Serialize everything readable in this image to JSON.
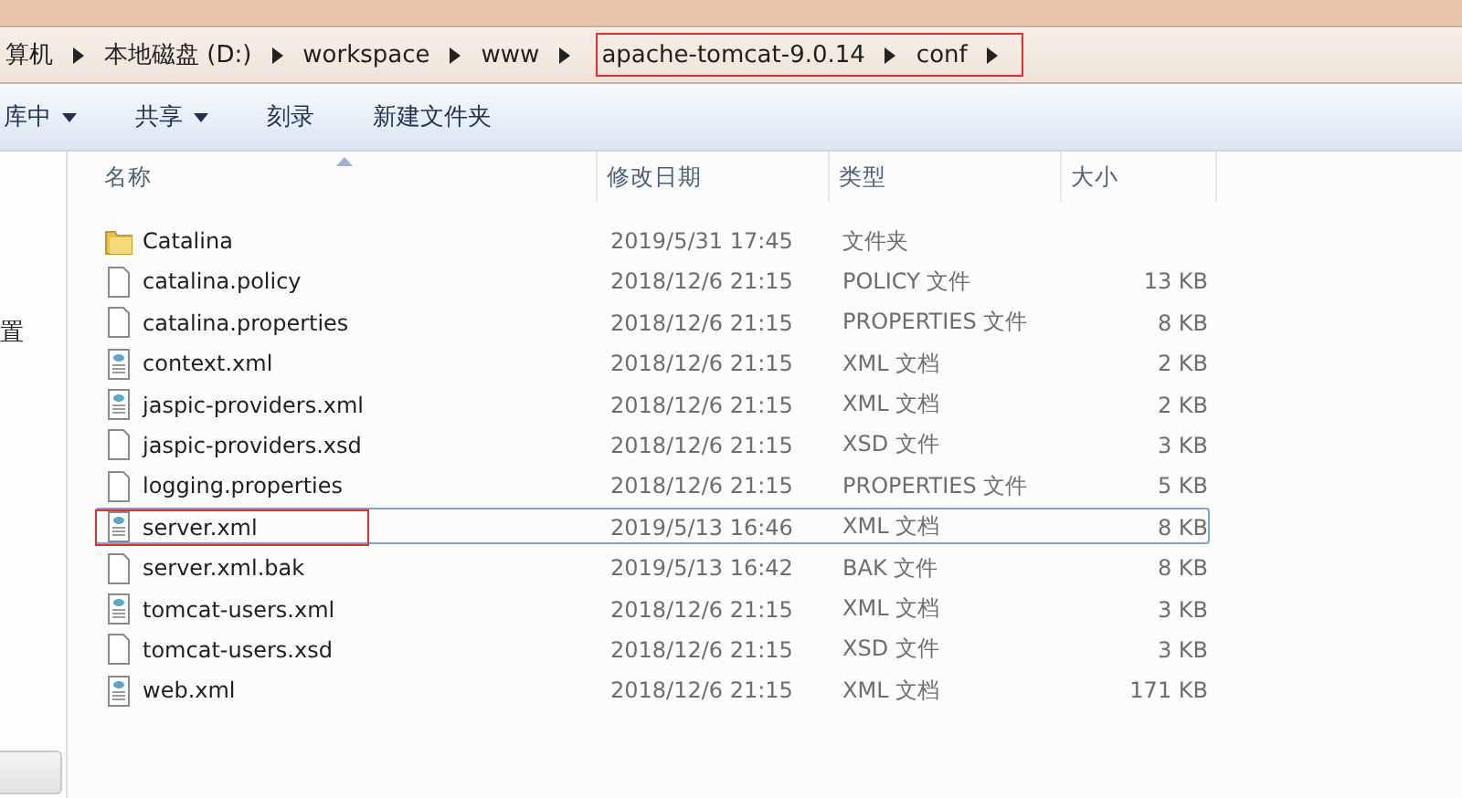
{
  "breadcrumb": [
    {
      "label": "算机",
      "annotated": false
    },
    {
      "label": "本地磁盘 (D:)",
      "annotated": false
    },
    {
      "label": "workspace",
      "annotated": false
    },
    {
      "label": "www",
      "annotated": false
    },
    {
      "label": "apache-tomcat-9.0.14",
      "annotated": true
    },
    {
      "label": "conf",
      "annotated": true
    }
  ],
  "toolbar": [
    {
      "label": "库中",
      "dropdown": true
    },
    {
      "label": "共享",
      "dropdown": true
    },
    {
      "label": "刻录",
      "dropdown": false
    },
    {
      "label": "新建文件夹",
      "dropdown": false
    }
  ],
  "nav_pane": {
    "items": [
      "置"
    ]
  },
  "columns": [
    "名称",
    "修改日期",
    "类型",
    "大小"
  ],
  "files": [
    {
      "kind": "folder",
      "name": "Catalina",
      "date": "2019/5/31 17:45",
      "type": "文件夹",
      "focused": false,
      "annotated": false
    },
    {
      "kind": "file",
      "name": "catalina.policy",
      "date": "2018/12/6 21:15",
      "type": "POLICY 文件",
      "size": "13 KB",
      "focused": false,
      "annotated": false
    },
    {
      "kind": "file",
      "name": "catalina.properties",
      "date": "2018/12/6 21:15",
      "type": "PROPERTIES 文件",
      "size": "8 KB",
      "focused": false,
      "annotated": false
    },
    {
      "kind": "xml",
      "name": "context.xml",
      "date": "2018/12/6 21:15",
      "type": "XML 文档",
      "size": "2 KB",
      "focused": false,
      "annotated": false
    },
    {
      "kind": "xml",
      "name": "jaspic-providers.xml",
      "date": "2018/12/6 21:15",
      "type": "XML 文档",
      "size": "2 KB",
      "focused": false,
      "annotated": false
    },
    {
      "kind": "file",
      "name": "jaspic-providers.xsd",
      "date": "2018/12/6 21:15",
      "type": "XSD 文件",
      "size": "3 KB",
      "focused": false,
      "annotated": false
    },
    {
      "kind": "file",
      "name": "logging.properties",
      "date": "2018/12/6 21:15",
      "type": "PROPERTIES 文件",
      "size": "5 KB",
      "focused": false,
      "annotated": false
    },
    {
      "kind": "xml",
      "name": "server.xml",
      "date": "2019/5/13 16:46",
      "type": "XML 文档",
      "size": "8 KB",
      "focused": true,
      "annotated": true
    },
    {
      "kind": "file",
      "name": "server.xml.bak",
      "date": "2019/5/13 16:42",
      "type": "BAK 文件",
      "size": "8 KB",
      "focused": false,
      "annotated": false
    },
    {
      "kind": "xml",
      "name": "tomcat-users.xml",
      "date": "2018/12/6 21:15",
      "type": "XML 文档",
      "size": "3 KB",
      "focused": false,
      "annotated": false
    },
    {
      "kind": "file",
      "name": "tomcat-users.xsd",
      "date": "2018/12/6 21:15",
      "type": "XSD 文件",
      "size": "3 KB",
      "focused": false,
      "annotated": false
    },
    {
      "kind": "xml",
      "name": "web.xml",
      "date": "2018/12/6 21:15",
      "type": "XML 文档",
      "size": "171 KB",
      "focused": false,
      "annotated": false
    }
  ]
}
